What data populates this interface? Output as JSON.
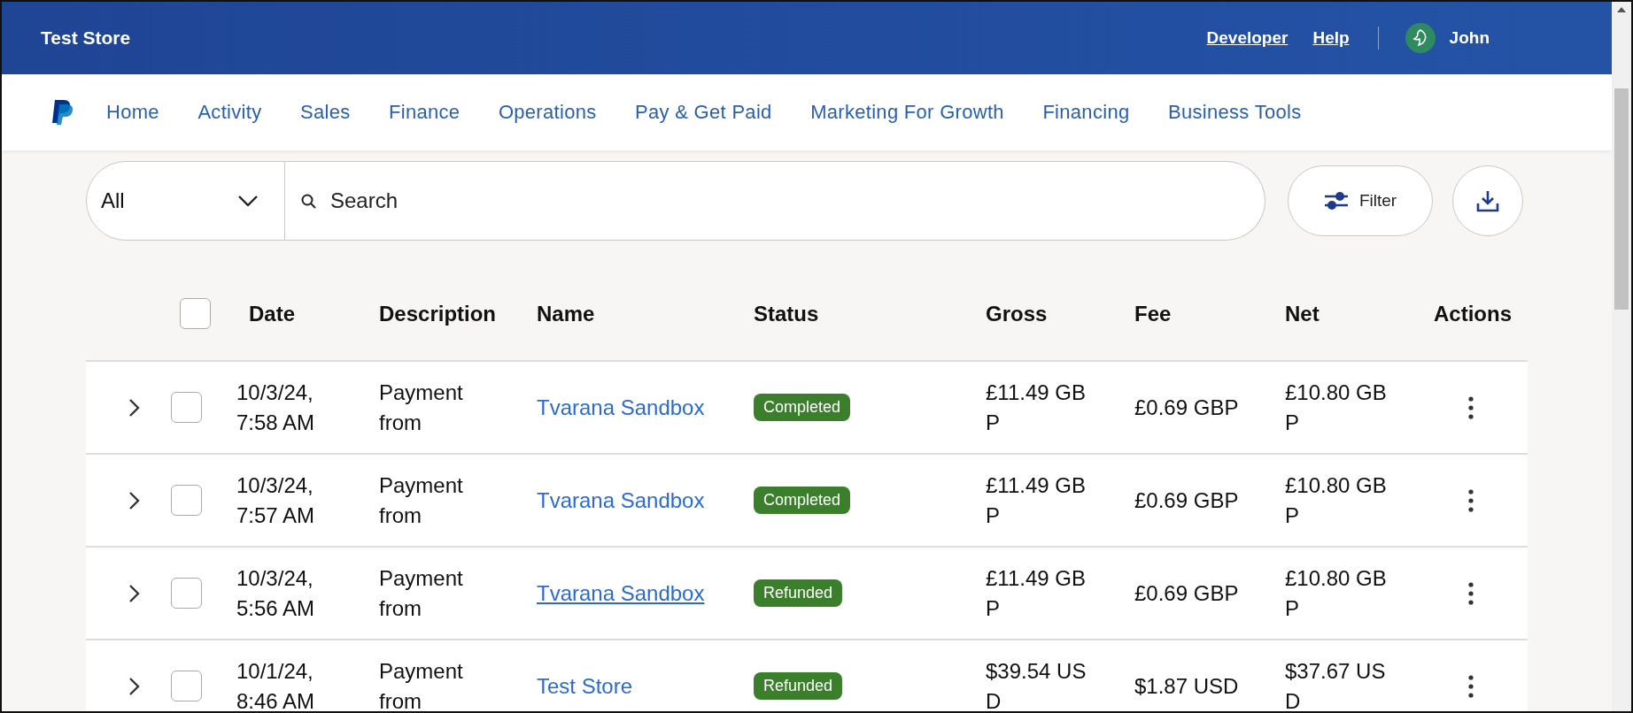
{
  "header": {
    "store_name": "Test Store",
    "links": [
      {
        "label": "Developer"
      },
      {
        "label": "Help"
      }
    ],
    "user": "John"
  },
  "nav": {
    "items": [
      {
        "label": "Home"
      },
      {
        "label": "Activity"
      },
      {
        "label": "Sales"
      },
      {
        "label": "Finance"
      },
      {
        "label": "Operations"
      },
      {
        "label": "Pay & Get Paid"
      },
      {
        "label": "Marketing For Growth"
      },
      {
        "label": "Financing"
      },
      {
        "label": "Business Tools"
      }
    ]
  },
  "search": {
    "scope": "All",
    "placeholder": "Search"
  },
  "filter_button": "Filter",
  "table": {
    "select_all_checked": false,
    "columns": [
      "Date",
      "Description",
      "Name",
      "Status",
      "Gross",
      "Fee",
      "Net",
      "Actions"
    ],
    "rows": [
      {
        "date": "10/3/24, 7:58 AM",
        "description": "Payment from",
        "name": "Tvarana Sandbox",
        "hovered": false,
        "checked": false,
        "status": "Completed",
        "gross": "£11.49 GBP",
        "fee": "£0.69 GBP",
        "net": "£10.80 GBP"
      },
      {
        "date": "10/3/24, 7:57 AM",
        "description": "Payment from",
        "name": "Tvarana Sandbox",
        "hovered": false,
        "checked": false,
        "status": "Completed",
        "gross": "£11.49 GBP",
        "fee": "£0.69 GBP",
        "net": "£10.80 GBP"
      },
      {
        "date": "10/3/24, 5:56 AM",
        "description": "Payment from",
        "name": "Tvarana Sandbox",
        "hovered": true,
        "checked": false,
        "status": "Refunded",
        "gross": "£11.49 GBP",
        "fee": "£0.69 GBP",
        "net": "£10.80 GBP"
      },
      {
        "date": "10/1/24, 8:46 AM",
        "description": "Payment from",
        "name": "Test Store",
        "hovered": false,
        "checked": false,
        "status": "Refunded",
        "gross": "$39.54 USD",
        "fee": "$1.87 USD",
        "net": "$37.67 USD"
      }
    ]
  }
}
